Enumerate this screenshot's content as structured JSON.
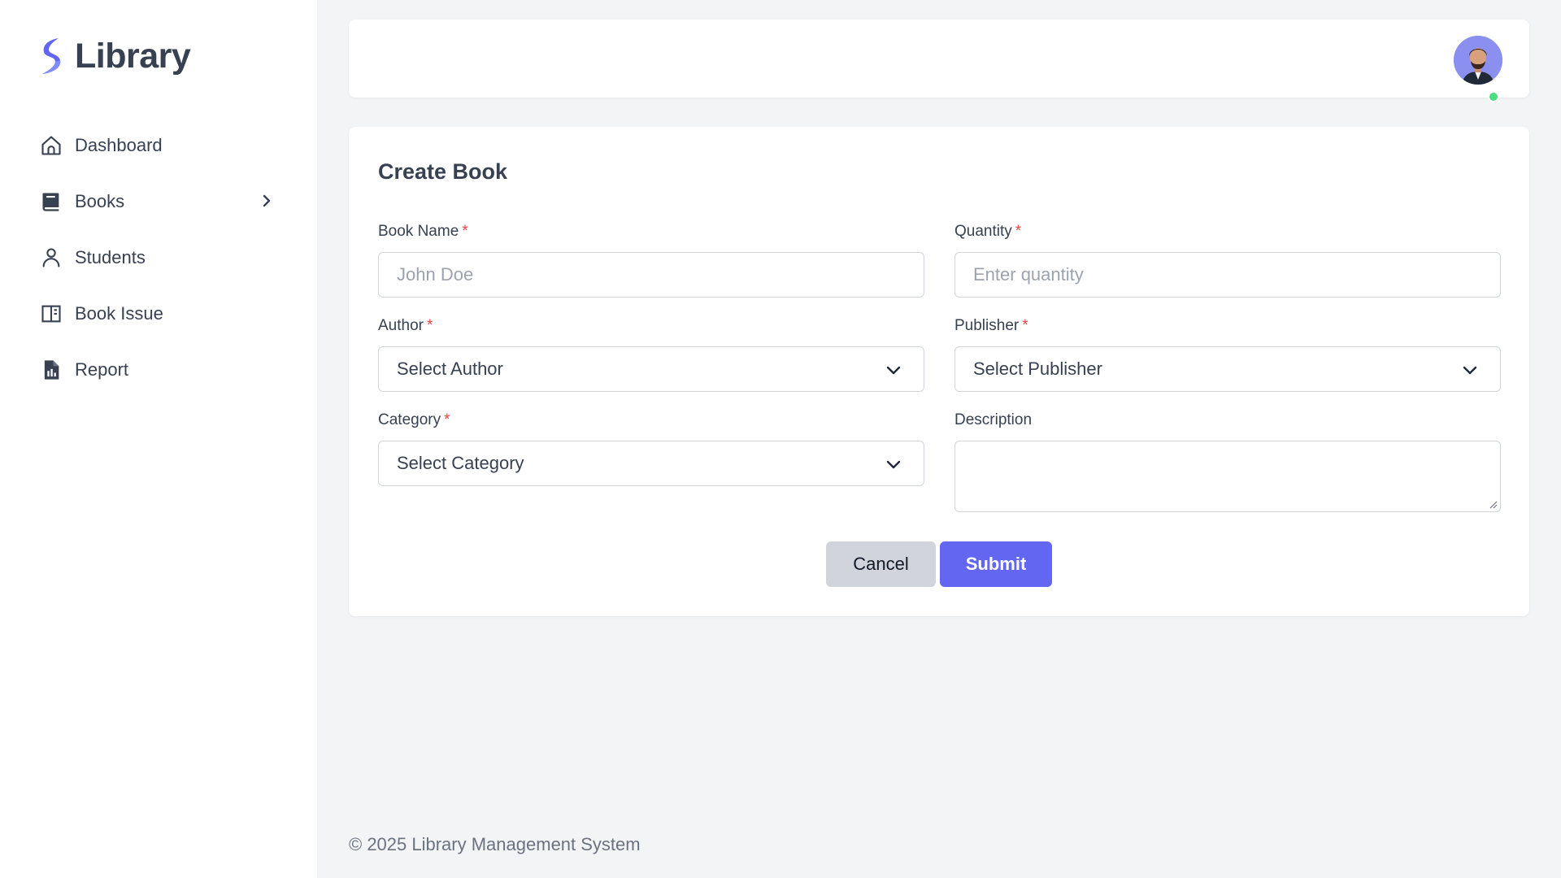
{
  "brand": {
    "name": "Library",
    "accent": "#6366f1"
  },
  "sidebar": {
    "items": [
      {
        "label": "Dashboard",
        "icon": "home-icon"
      },
      {
        "label": "Books",
        "icon": "book-icon",
        "has_submenu": true
      },
      {
        "label": "Students",
        "icon": "user-icon"
      },
      {
        "label": "Book Issue",
        "icon": "book-open-icon"
      },
      {
        "label": "Report",
        "icon": "report-file-icon"
      }
    ]
  },
  "header": {
    "avatar_status": "online",
    "status_color": "#4ade80"
  },
  "form": {
    "title": "Create Book",
    "required_marker": "*",
    "book_name": {
      "label": "Book Name",
      "placeholder": "John Doe",
      "value": ""
    },
    "quantity": {
      "label": "Quantity",
      "placeholder": "Enter quantity",
      "value": ""
    },
    "author": {
      "label": "Author",
      "selected": "Select Author"
    },
    "publisher": {
      "label": "Publisher",
      "selected": "Select Publisher"
    },
    "category": {
      "label": "Category",
      "selected": "Select Category"
    },
    "description": {
      "label": "Description",
      "value": ""
    },
    "cancel_label": "Cancel",
    "submit_label": "Submit"
  },
  "footer": {
    "text": "© 2025 Library Management System"
  }
}
